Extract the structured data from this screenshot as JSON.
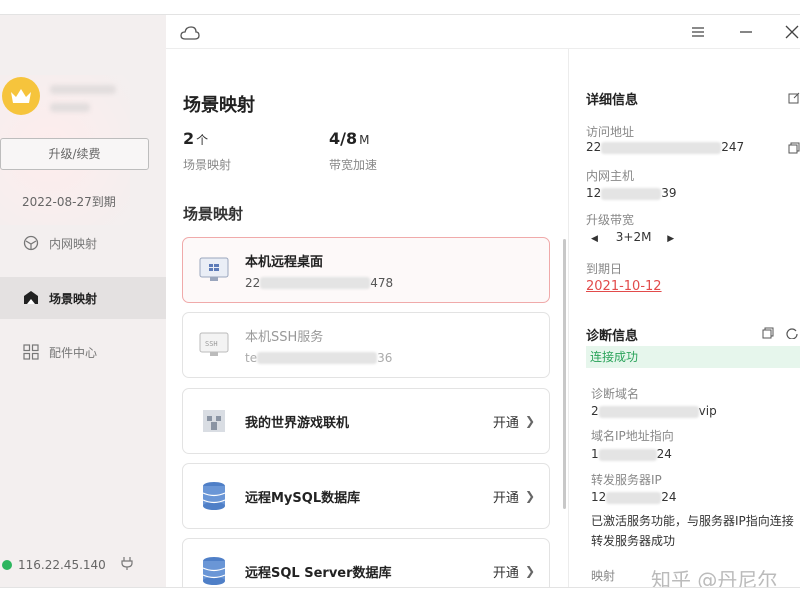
{
  "sidebar": {
    "upgrade_label": "升级/续费",
    "expire_date": "2022-08-27到期",
    "nav": [
      {
        "label": "内网映射",
        "icon": "network-icon"
      },
      {
        "label": "场景映射",
        "icon": "scene-icon"
      },
      {
        "label": "配件中心",
        "icon": "apps-grid-icon"
      }
    ],
    "ip": "116.22.45.140"
  },
  "main": {
    "title": "场景映射",
    "stats": [
      {
        "value": "2",
        "unit": "个",
        "label": "场景映射"
      },
      {
        "value": "4/8",
        "unit": "M",
        "label": "带宽加速"
      }
    ],
    "section_title": "场景映射",
    "cards": [
      {
        "title": "本机远程桌面",
        "sub_prefix": "22",
        "sub_suffix": "478",
        "state": "selected"
      },
      {
        "title": "本机SSH服务",
        "sub_prefix": "te",
        "sub_suffix": "36",
        "state": "disabled"
      },
      {
        "title": "我的世界游戏联机",
        "action": "开通"
      },
      {
        "title": "远程MySQL数据库",
        "action": "开通"
      },
      {
        "title": "远程SQL Server数据库",
        "action": "开通"
      }
    ]
  },
  "details": {
    "title": "详细信息",
    "access_label": "访问地址",
    "access_prefix": "22",
    "access_suffix": "247",
    "host_label": "内网主机",
    "host_prefix": "12",
    "host_suffix": "39",
    "bandwidth_label": "升级带宽",
    "bandwidth_value": "3+2M",
    "expiry_label": "到期日",
    "expiry_value": "2021-10-12"
  },
  "diagnostics": {
    "title": "诊断信息",
    "status": "连接成功",
    "domain_label": "诊断域名",
    "domain_prefix": "2",
    "domain_suffix": "vip",
    "dns_label": "域名IP地址指向",
    "dns_prefix": "1",
    "dns_suffix": "24",
    "forward_label": "转发服务器IP",
    "forward_prefix": "12",
    "forward_suffix": "24",
    "note": "已激活服务功能，与服务器IP指向连接转发服务器成功",
    "mapping_label": "映射"
  },
  "watermark": "知乎 @丹尼尔"
}
